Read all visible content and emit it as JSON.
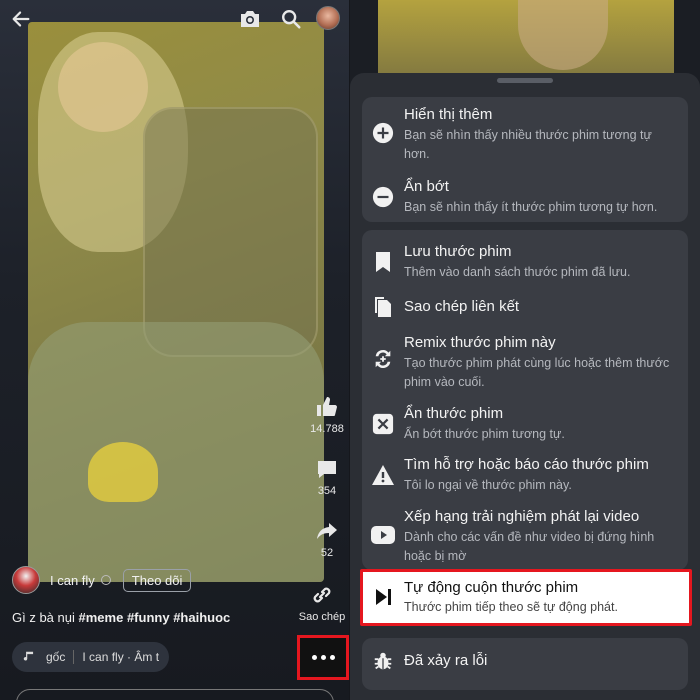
{
  "left": {
    "like_count": "14.788",
    "comment_count": "354",
    "share_count": "52",
    "copy_label": "Sao chép",
    "author_name": "I can fly",
    "follow_label": "Theo dõi",
    "caption_text": "Gì z bà nụi",
    "caption_tags": [
      "#meme",
      "#funny",
      "#haihuoc"
    ],
    "audio_label": "gốc",
    "audio_artist": "I can fly · Âm t"
  },
  "menu": {
    "group1": [
      {
        "title": "Hiển thị thêm",
        "desc": "Bạn sẽ nhìn thấy nhiều thước phim tương tự hơn.",
        "icon": "plus-circle-icon"
      },
      {
        "title": "Ẩn bớt",
        "desc": "Bạn sẽ nhìn thấy ít thước phim tương tự hơn.",
        "icon": "minus-circle-icon"
      }
    ],
    "group2": [
      {
        "title": "Lưu thước phim",
        "desc": "Thêm vào danh sách thước phim đã lưu.",
        "icon": "bookmark-icon"
      },
      {
        "title": "Sao chép liên kết",
        "desc": "",
        "icon": "copy-icon"
      },
      {
        "title": "Remix thước phim này",
        "desc": "Tạo thước phim phát cùng lúc hoặc thêm thước phim vào cuối.",
        "icon": "remix-icon"
      },
      {
        "title": "Ẩn thước phim",
        "desc": "Ẩn bớt thước phim tương tự.",
        "icon": "hide-icon"
      },
      {
        "title": "Tìm hỗ trợ hoặc báo cáo thước phim",
        "desc": "Tôi lo ngại về thước phim này.",
        "icon": "warning-icon"
      },
      {
        "title": "Xếp hạng trải nghiệm phát lại video",
        "desc": "Dành cho các vấn đề như video bị đứng hình hoặc bị mờ",
        "icon": "play-rating-icon"
      }
    ],
    "highlighted": {
      "title": "Tự động cuộn thước phim",
      "desc": "Thước phim tiếp theo sẽ tự động phát.",
      "icon": "skip-next-icon"
    },
    "group3": [
      {
        "title": "Đã xảy ra lỗi",
        "desc": "",
        "icon": "bug-icon"
      }
    ]
  },
  "colors": {
    "highlight_border": "#e5171f",
    "sheet_bg": "#2b2e34",
    "card_bg": "#3a3d44"
  }
}
